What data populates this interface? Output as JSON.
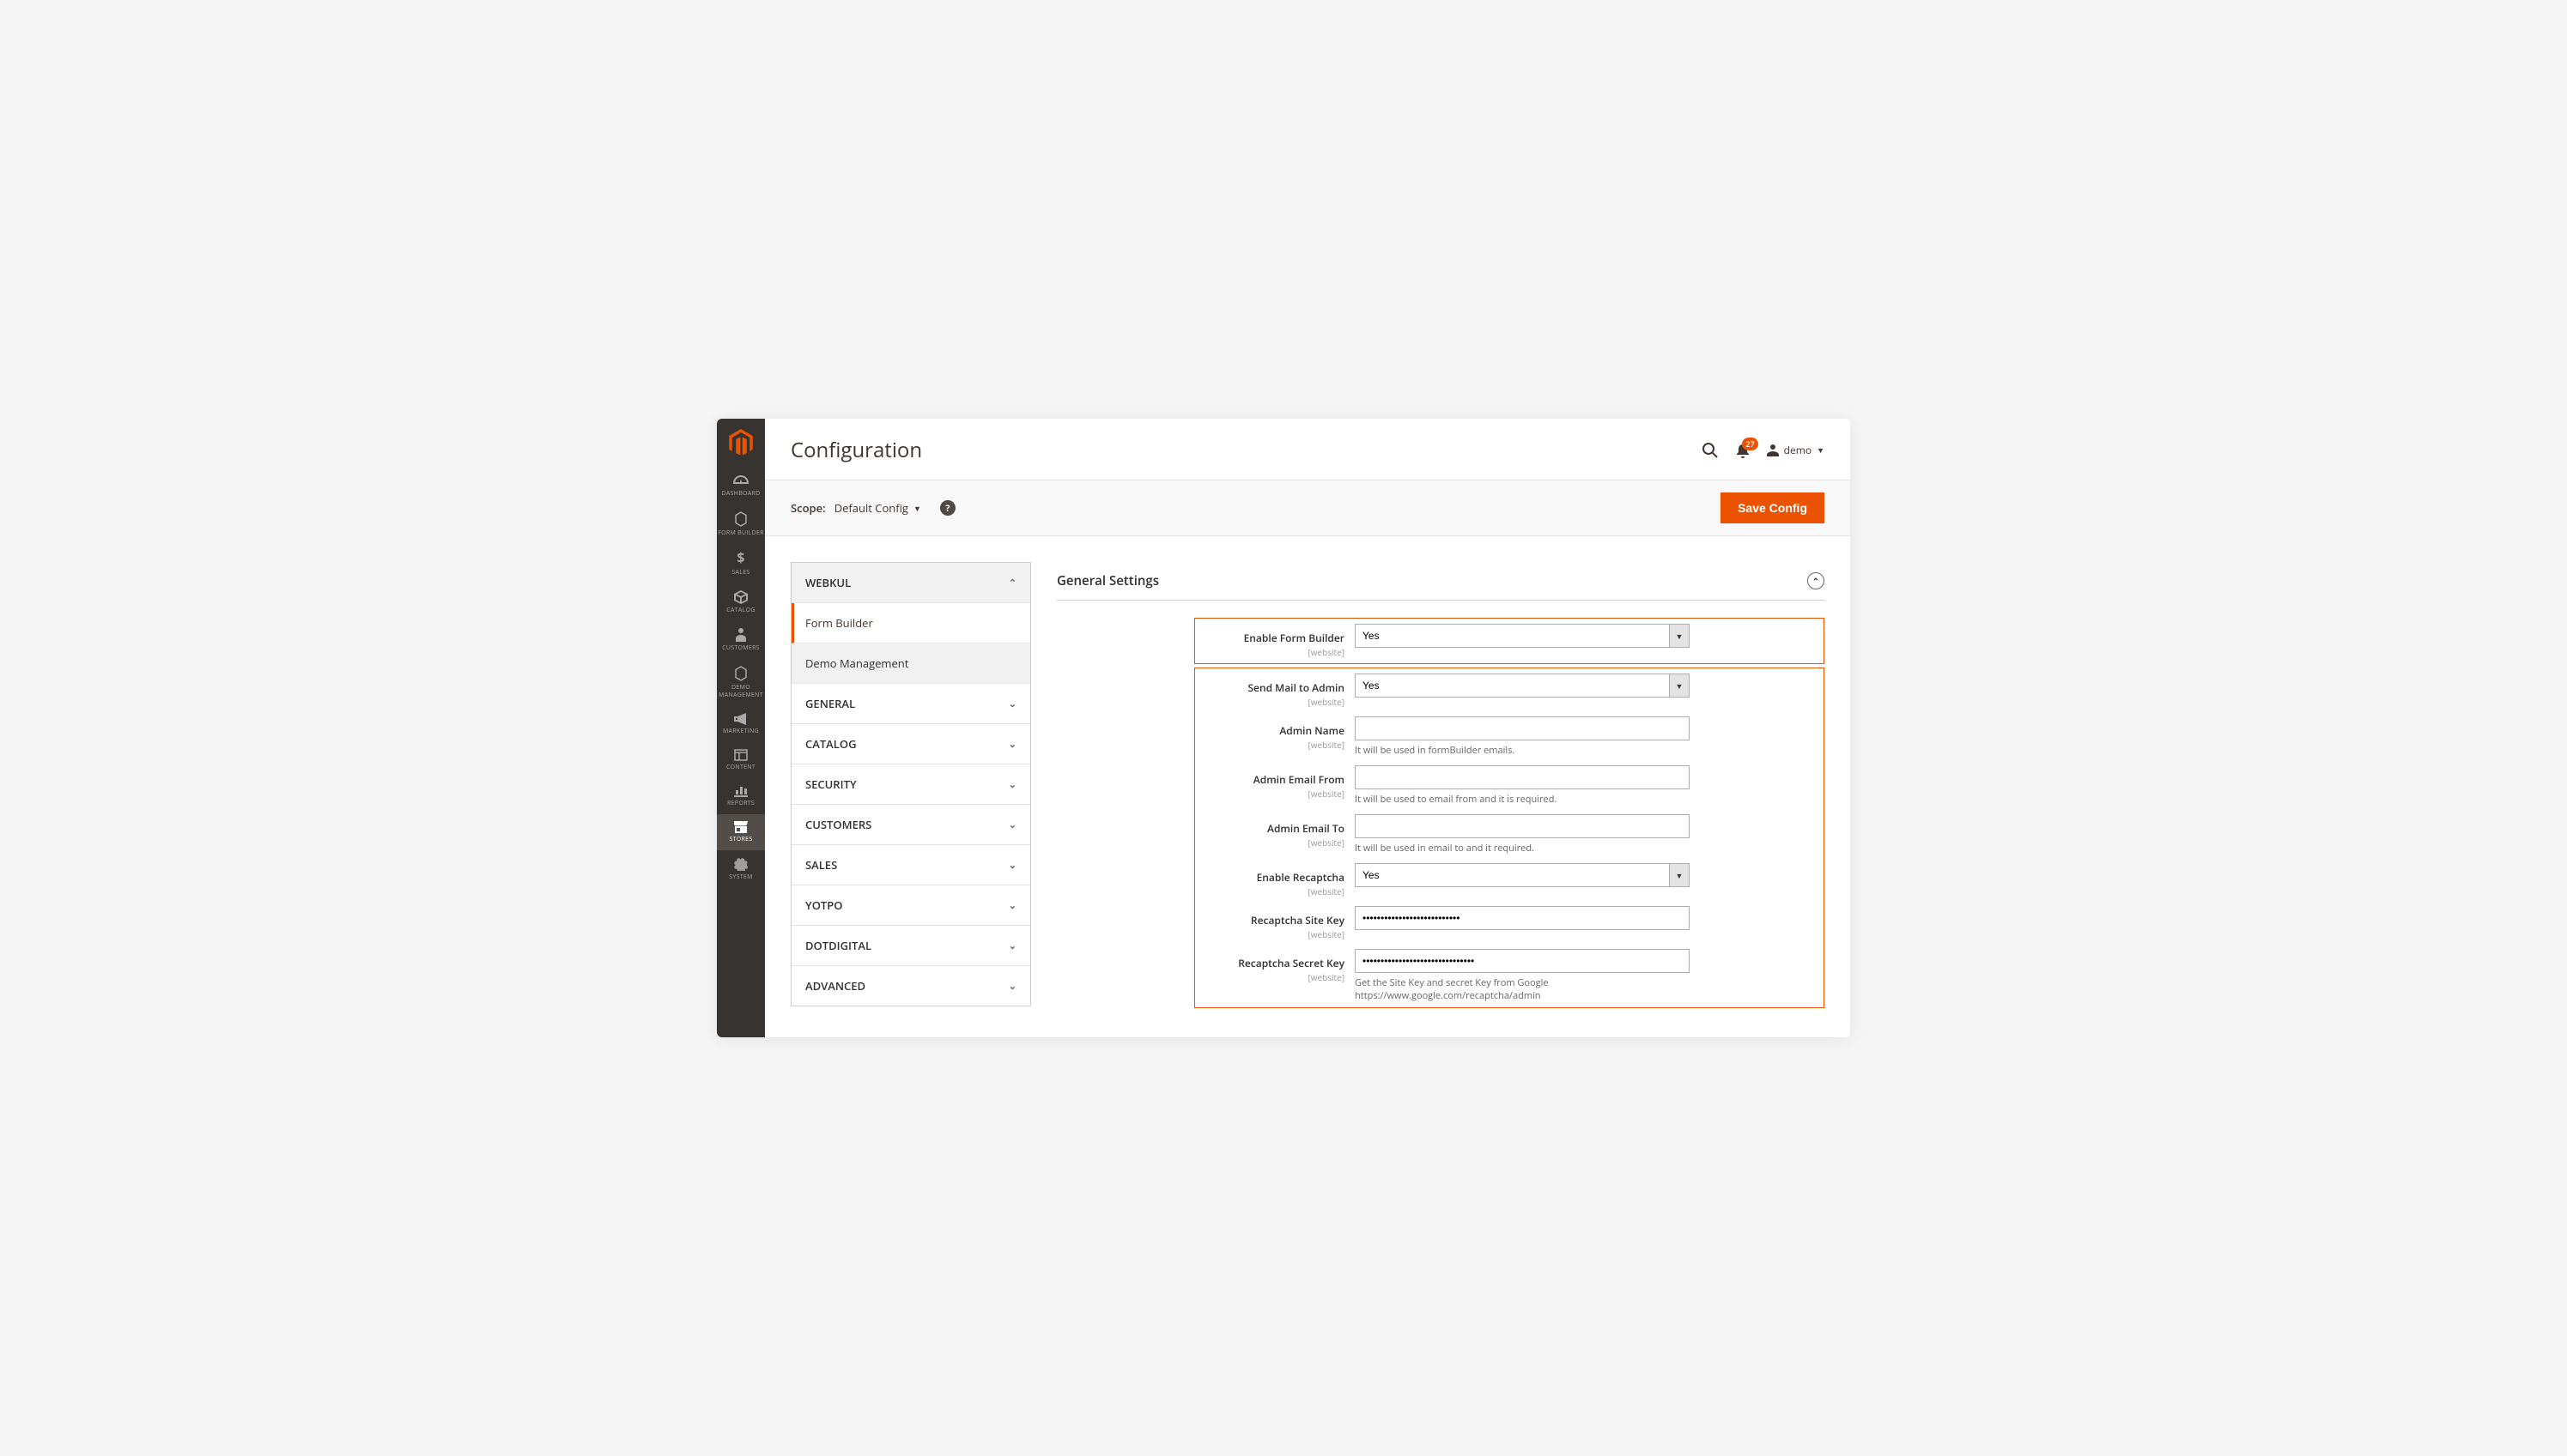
{
  "page": {
    "title": "Configuration"
  },
  "header": {
    "notifications_count": "27",
    "user_label": "demo"
  },
  "toolbar": {
    "scope_label": "Scope:",
    "scope_value": "Default Config",
    "save_label": "Save Config"
  },
  "sidebar": {
    "items": [
      {
        "label": "DASHBOARD"
      },
      {
        "label": "FORM BUILDER"
      },
      {
        "label": "SALES"
      },
      {
        "label": "CATALOG"
      },
      {
        "label": "CUSTOMERS"
      },
      {
        "label": "DEMO MANAGEMENT"
      },
      {
        "label": "MARKETING"
      },
      {
        "label": "CONTENT"
      },
      {
        "label": "REPORTS"
      },
      {
        "label": "STORES"
      },
      {
        "label": "SYSTEM"
      }
    ]
  },
  "config_nav": {
    "sections": [
      {
        "label": "WEBKUL",
        "subitems": [
          {
            "label": "Form Builder"
          },
          {
            "label": "Demo Management"
          }
        ]
      },
      {
        "label": "GENERAL"
      },
      {
        "label": "CATALOG"
      },
      {
        "label": "SECURITY"
      },
      {
        "label": "CUSTOMERS"
      },
      {
        "label": "SALES"
      },
      {
        "label": "YOTPO"
      },
      {
        "label": "DOTDIGITAL"
      },
      {
        "label": "ADVANCED"
      }
    ]
  },
  "settings": {
    "section_title": "General Settings",
    "scope_tag": "[website]",
    "fields": {
      "enable_form_builder": {
        "label": "Enable Form Builder",
        "value": "Yes"
      },
      "send_mail_admin": {
        "label": "Send Mail to Admin",
        "value": "Yes"
      },
      "admin_name": {
        "label": "Admin Name",
        "value": "",
        "hint": "It will be used in formBuilder emails."
      },
      "admin_email_from": {
        "label": "Admin Email From",
        "value": "",
        "hint": "It will be used to email from and it is required."
      },
      "admin_email_to": {
        "label": "Admin Email To",
        "value": "",
        "hint": "It will be used in email to and it required."
      },
      "enable_recaptcha": {
        "label": "Enable Recaptcha",
        "value": "Yes"
      },
      "recaptcha_site_key": {
        "label": "Recaptcha Site Key",
        "value": "•••••••••••••••••••••••••••"
      },
      "recaptcha_secret_key": {
        "label": "Recaptcha Secret Key",
        "value": "•••••••••••••••••••••••••••••••",
        "hint": "Get the Site Key and secret Key from Google https://www.google.com/recaptcha/admin"
      }
    }
  }
}
